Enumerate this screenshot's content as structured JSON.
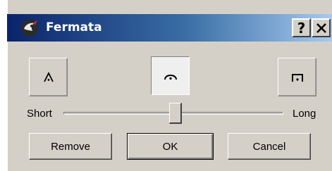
{
  "window": {
    "title": "Fermata",
    "help_label": "?",
    "close_label": "✕"
  },
  "fermata_types": {
    "selected": "normal",
    "options": [
      {
        "id": "short",
        "icon": "short-fermata-icon"
      },
      {
        "id": "normal",
        "icon": "normal-fermata-icon"
      },
      {
        "id": "long",
        "icon": "long-fermata-icon"
      }
    ]
  },
  "duration": {
    "min_label": "Short",
    "max_label": "Long",
    "value_fraction": 0.5
  },
  "buttons": {
    "remove": "Remove",
    "ok": "OK",
    "cancel": "Cancel"
  },
  "colors": {
    "title_gradient_start": "#0a246a",
    "title_gradient_end": "#a6caf0",
    "dialog_background": "#d4d0c8"
  }
}
